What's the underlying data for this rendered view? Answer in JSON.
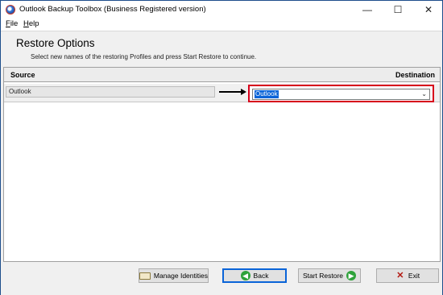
{
  "window": {
    "title": "Outlook Backup Toolbox (Business Registered version)",
    "minimize_glyph": "—",
    "maximize_glyph": "☐",
    "close_glyph": "✕"
  },
  "menu": {
    "file_accel": "F",
    "file_rest": "ile",
    "help_accel": "H",
    "help_rest": "elp"
  },
  "header": {
    "title": "Restore Options",
    "subtitle": "Select new names of the restoring Profiles and press Start Restore to continue."
  },
  "grid": {
    "columns": {
      "source": "Source",
      "destination": "Destination"
    },
    "rows": [
      {
        "source": "Outlook",
        "destination": "Outlook"
      }
    ]
  },
  "buttons": {
    "manage_identities": "Manage Identities",
    "back": "Back",
    "start_restore": "Start Restore",
    "exit": "Exit"
  },
  "icons": {
    "app": "app-globe-icon",
    "back": "back-arrow-icon",
    "start": "forward-arrow-icon",
    "exit": "red-x-icon",
    "manage": "id-card-icon"
  },
  "colors": {
    "highlight_border": "#d7001b",
    "selection": "#0a64d8",
    "accent_green": "#2ea23a"
  }
}
